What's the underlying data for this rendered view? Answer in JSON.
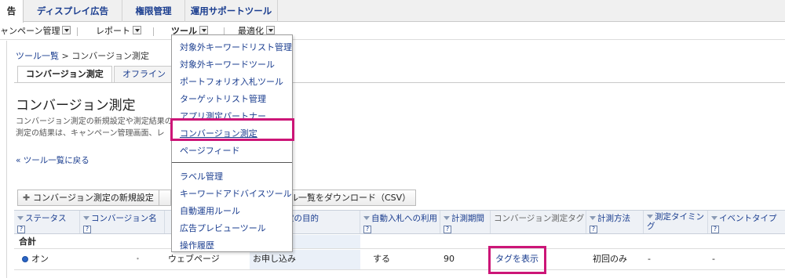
{
  "top_tabs": [
    "告",
    "ディスプレイ広告",
    "権限管理",
    "運用サポートツール"
  ],
  "subnav": [
    {
      "label": "ャンペーン管理"
    },
    {
      "label": "レポート"
    },
    {
      "label": "ツール"
    },
    {
      "label": "最適化"
    }
  ],
  "breadcrumb": {
    "root": "ツール一覧",
    "sep": ">",
    "current": "コンバージョン測定"
  },
  "inner_tabs": [
    "コンバージョン測定",
    "オフラインコ"
  ],
  "page_title": "コンバージョン測定",
  "description": [
    "コンバージョン測定の新規設定や測定結果の",
    "測定の結果は、キャンペーン管理画面、レ"
  ],
  "back_link": "« ツール一覧に戻る",
  "toolbar": {
    "new_button": "コンバージョン測定の新規設定",
    "partial_button": "",
    "download_button": "ル一覧をダウンロード（CSV）"
  },
  "menu": {
    "group1": [
      "対象外キーワードリスト管理",
      "対象外キーワードツール",
      "ポートフォリオ入札ツール",
      "ターゲットリスト管理",
      "アプリ測定パートナー",
      "コンバージョン測定",
      "ページフィード"
    ],
    "group2": [
      "ラベル管理",
      "キーワードアドバイスツール",
      "自動運用ルール",
      "広告プレビューツール",
      "操作履歴"
    ]
  },
  "table": {
    "headers": [
      "ステータス",
      "コンバージョン名",
      "",
      "ション測定の目的",
      "自動入札への利用",
      "計測期間",
      "コンバージョン測定タグ",
      "計測方法",
      "測定タイミング",
      "イベントタイプ"
    ],
    "help_mark": "?",
    "total_label": "合計",
    "row": {
      "status": "オン",
      "name": "・",
      "category": "ウェブページ",
      "purpose": "お申し込み",
      "auto_bid": "する",
      "period": "90",
      "tag_link": "タグを表示",
      "method": "初回のみ",
      "timing": "-",
      "event_type": "-"
    }
  },
  "colors": {
    "link": "#1a3d8f",
    "highlight": "#cc1577"
  }
}
